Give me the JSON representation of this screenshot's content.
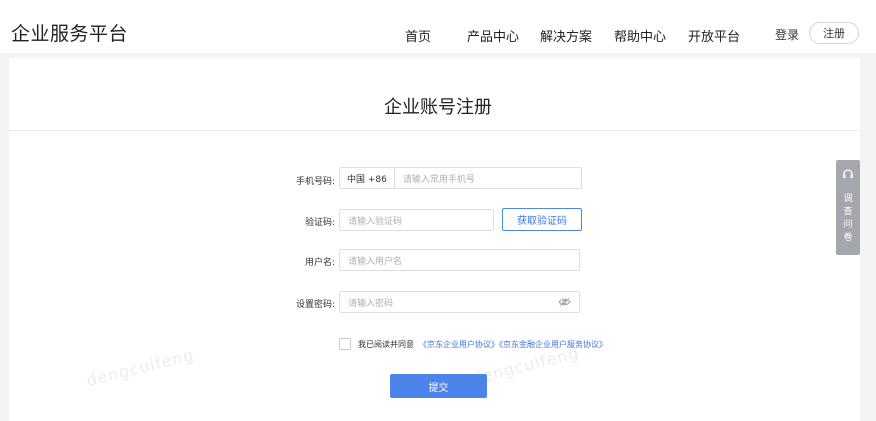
{
  "header": {
    "brand": "企业服务平台",
    "nav": [
      "首页",
      "产品中心",
      "解决方案",
      "帮助中心",
      "开放平台"
    ],
    "login_label": "登录",
    "register_label": "注册"
  },
  "form": {
    "title": "企业账号注册",
    "phone": {
      "label": "手机号码:",
      "country_code": "中国 +86",
      "placeholder": "请输入常用手机号"
    },
    "verify": {
      "label": "验证码:",
      "placeholder": "请输入验证码",
      "button": "获取验证码"
    },
    "username": {
      "label": "用户名:",
      "placeholder": "请输入用户名"
    },
    "password": {
      "label": "设置密码:",
      "placeholder": "请输入密码"
    },
    "agree": {
      "text": "我已阅读并同意",
      "links": "《京东企业用户协议》《京东金融企业用户服务协议》"
    },
    "submit_label": "提交"
  },
  "survey": {
    "label": "调查问卷"
  },
  "watermark": "dengcuifeng",
  "colors": {
    "accent": "#4c84ea",
    "link": "#3c77e0",
    "survey_tab": "#a4a7ab"
  }
}
